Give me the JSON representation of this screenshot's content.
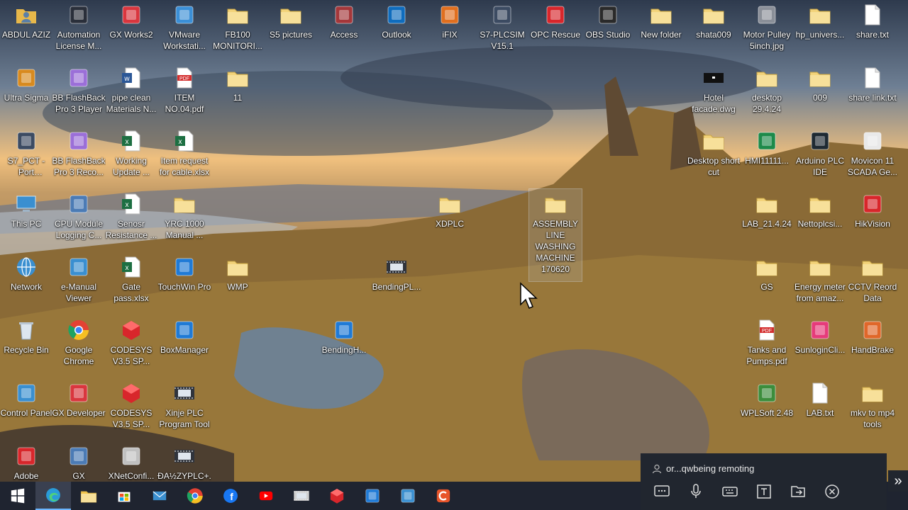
{
  "desktop": {
    "icons": [
      {
        "label": "ABDUL AZIZ",
        "icon": "user-folder-icon",
        "color": "#e8b84a"
      },
      {
        "label": "Automation License M...",
        "icon": "license-manager-icon",
        "color": "#2a2f3a"
      },
      {
        "label": "GX Works2",
        "icon": "gx-works-icon",
        "color": "#d9363e"
      },
      {
        "label": "VMware Workstati...",
        "icon": "vmware-icon",
        "color": "#3b8fd6"
      },
      {
        "label": "FB100 MONITORI...",
        "icon": "folder-icon",
        "color": "#f3d37a"
      },
      {
        "label": "S5 pictures",
        "icon": "folder-icon",
        "color": "#f3d37a"
      },
      {
        "label": "Access",
        "icon": "access-icon",
        "color": "#a4373a"
      },
      {
        "label": "Outlook",
        "icon": "outlook-icon",
        "color": "#0f6cbd"
      },
      {
        "label": "iFIX",
        "icon": "ifix-icon",
        "color": "#e06f1f"
      },
      {
        "label": "S7-PLCSIM V15.1",
        "icon": "plcsim-icon",
        "color": "#3c4b62"
      },
      {
        "label": "OPC Rescue",
        "icon": "opc-rescue-icon",
        "color": "#d8262b"
      },
      {
        "label": "OBS Studio",
        "icon": "obs-icon",
        "color": "#2a2a2a"
      },
      {
        "label": "New folder",
        "icon": "folder-icon",
        "color": "#f3d37a"
      },
      {
        "label": "shata009",
        "icon": "folder-icon",
        "color": "#f3d37a"
      },
      {
        "label": "Motor Pulley 5inch.jpg",
        "icon": "image-file-icon",
        "color": "#8a8f98"
      },
      {
        "label": "hp_univers...",
        "icon": "folder-icon",
        "color": "#f3d37a"
      },
      {
        "label": "share.txt",
        "icon": "text-file-icon",
        "color": "#ffffff"
      },
      {
        "label": "Ultra Sigma",
        "icon": "ultra-sigma-icon",
        "color": "#d88a1f"
      },
      {
        "label": "BB FlashBack Pro 3 Player",
        "icon": "flashback-icon",
        "color": "#9b6fd8"
      },
      {
        "label": "pipe clean Materials N...",
        "icon": "word-file-icon",
        "color": "#2b5797"
      },
      {
        "label": "ITEM NO.04.pdf",
        "icon": "pdf-file-icon",
        "color": "#d32f2f"
      },
      {
        "label": "11",
        "icon": "folder-icon",
        "color": "#f3d37a"
      },
      {
        "label": "Hotel facade.dwg",
        "icon": "dwg-file-icon",
        "color": "#111111"
      },
      {
        "label": "desktop 29.4.24",
        "icon": "folder-icon",
        "color": "#f3d37a"
      },
      {
        "label": "009",
        "icon": "folder-icon",
        "color": "#f3d37a"
      },
      {
        "label": "share link.txt",
        "icon": "text-file-icon",
        "color": "#ffffff"
      },
      {
        "label": "S7_PCT - Port Configurati...",
        "icon": "s7-pct-icon",
        "color": "#3c4b62"
      },
      {
        "label": "BB FlashBack Pro 3 Reco...",
        "icon": "flashback-recorder-icon",
        "color": "#9b6fd8"
      },
      {
        "label": "Working Update ...",
        "icon": "excel-file-icon",
        "color": "#1d6f42"
      },
      {
        "label": "Item request for cable.xlsx",
        "icon": "excel-file-icon",
        "color": "#1d6f42"
      },
      {
        "label": "Desktop short cut",
        "icon": "folder-icon",
        "color": "#f3d37a"
      },
      {
        "label": "HMI11111...",
        "icon": "hmi-icon",
        "color": "#1d8a4a"
      },
      {
        "label": "Arduino PLC IDE",
        "icon": "arduino-icon",
        "color": "#1f2a33"
      },
      {
        "label": "Movicon 11 SCADA Ge...",
        "icon": "movicon-icon",
        "color": "#e9e9e9"
      },
      {
        "label": "This PC",
        "icon": "pc-icon",
        "color": "#3a8fd0"
      },
      {
        "label": "CPU Module Logging C...",
        "icon": "cpu-logging-icon",
        "color": "#4b7bb5"
      },
      {
        "label": "Senosr Resistance ...",
        "icon": "excel-file-icon",
        "color": "#1d6f42"
      },
      {
        "label": "YRC 1000 Manual ...",
        "icon": "folder-icon",
        "color": "#f3d37a"
      },
      {
        "label": "XDPLC",
        "icon": "folder-icon",
        "color": "#f3d37a"
      },
      {
        "label": "ASSEMBLY LINE WASHING MACHINE 170620",
        "icon": "folder-icon",
        "color": "#f3d37a"
      },
      {
        "label": "LAB_21.4.24",
        "icon": "folder-icon",
        "color": "#f3d37a"
      },
      {
        "label": "Nettoplcsi...",
        "icon": "folder-icon",
        "color": "#f3d37a"
      },
      {
        "label": "HikVision",
        "icon": "hikvision-icon",
        "color": "#d8262b"
      },
      {
        "label": "Network",
        "icon": "network-icon",
        "color": "#3a8fd0"
      },
      {
        "label": "e-Manual Viewer",
        "icon": "emanual-icon",
        "color": "#3a8fd0"
      },
      {
        "label": "Gate pass.xlsx",
        "icon": "excel-file-icon",
        "color": "#1d6f42"
      },
      {
        "label": "TouchWin Pro",
        "icon": "touchwin-icon",
        "color": "#1f7ad6"
      },
      {
        "label": "WMP",
        "icon": "folder-icon",
        "color": "#f3d37a"
      },
      {
        "label": "BendingPL...",
        "icon": "film-icon",
        "color": "#30343c"
      },
      {
        "label": "GS",
        "icon": "folder-icon",
        "color": "#f3d37a"
      },
      {
        "label": "Energy meter from amaz...",
        "icon": "folder-icon",
        "color": "#f3d37a"
      },
      {
        "label": "CCTV Reord Data",
        "icon": "folder-icon",
        "color": "#f3d37a"
      },
      {
        "label": "Recycle Bin",
        "icon": "recycle-bin-icon",
        "color": "#cfd8e0"
      },
      {
        "label": "Google Chrome",
        "icon": "chrome-icon",
        "color": "#e34133"
      },
      {
        "label": "CODESYS V3.5 SP...",
        "icon": "codesys-icon",
        "color": "#d8262b"
      },
      {
        "label": "BoxManager",
        "icon": "box-manager-icon",
        "color": "#1f7ad6"
      },
      {
        "label": "BendingH...",
        "icon": "touchwin-file-icon",
        "color": "#1f7ad6"
      },
      {
        "label": "Tanks and Pumps.pdf",
        "icon": "pdf-file-icon",
        "color": "#d32f2f"
      },
      {
        "label": "SunloginCli...",
        "icon": "sunlogin-icon",
        "color": "#e63b7a"
      },
      {
        "label": "HandBrake",
        "icon": "handbrake-icon",
        "color": "#e0672a"
      },
      {
        "label": "Control Panel",
        "icon": "control-panel-icon",
        "color": "#3a8fd0"
      },
      {
        "label": "GX Developer",
        "icon": "gx-developer-icon",
        "color": "#d9363e"
      },
      {
        "label": "CODESYS V3.5 SP...",
        "icon": "codesys-icon",
        "color": "#d8262b"
      },
      {
        "label": "Xinje PLC Program Tool",
        "icon": "film-icon",
        "color": "#30343c"
      },
      {
        "label": "WPLSoft 2.48",
        "icon": "wplsoft-icon",
        "color": "#3c8d3c"
      },
      {
        "label": "LAB.txt",
        "icon": "text-file-icon",
        "color": "#ffffff"
      },
      {
        "label": "mkv to mp4 tools",
        "icon": "folder-icon",
        "color": "#f3d37a"
      },
      {
        "label": "Adobe",
        "icon": "adobe-icon",
        "color": "#d8262b"
      },
      {
        "label": "GX",
        "icon": "gx-icon",
        "color": "#4b7bb5"
      },
      {
        "label": "XNetConfi...",
        "icon": "xnet-icon",
        "color": "#c0c0c0"
      },
      {
        "label": "ĐA½ZYPLC+...",
        "icon": "film-icon",
        "color": "#30343c"
      }
    ]
  },
  "taskbar": {
    "items": [
      {
        "name": "start-button",
        "icon": "windows-icon",
        "color": "#ffffff",
        "active": false
      },
      {
        "name": "edge",
        "icon": "edge-icon",
        "color": "#2a9bd8",
        "active": true
      },
      {
        "name": "file-explorer",
        "icon": "folder-icon",
        "color": "#f3c54a",
        "active": false
      },
      {
        "name": "store",
        "icon": "store-icon",
        "color": "#e9e9e9",
        "active": false
      },
      {
        "name": "mail",
        "icon": "mail-icon",
        "color": "#3a8fd0",
        "active": false
      },
      {
        "name": "chrome",
        "icon": "chrome-icon",
        "color": "#e34133",
        "active": false
      },
      {
        "name": "facebook",
        "icon": "facebook-icon",
        "color": "#1877f2",
        "active": false
      },
      {
        "name": "youtube",
        "icon": "youtube-icon",
        "color": "#ff0000",
        "active": false
      },
      {
        "name": "xinje",
        "icon": "film-icon",
        "color": "#d0d0d0",
        "active": false
      },
      {
        "name": "codesys",
        "icon": "codesys-icon",
        "color": "#d8262b",
        "active": false
      },
      {
        "name": "touchwin",
        "icon": "touchwin-icon",
        "color": "#1f7ad6",
        "active": false
      },
      {
        "name": "remote",
        "icon": "remote-icon",
        "color": "#3a8fd0",
        "active": false
      },
      {
        "name": "cclean",
        "icon": "c-icon",
        "color": "#e8542a",
        "active": false
      }
    ]
  },
  "remote_panel": {
    "user_text": "or...qwbeing remoting",
    "tools": [
      "chat-icon",
      "microphone-icon",
      "keyboard-icon",
      "text-icon",
      "file-transfer-icon",
      "close-icon"
    ],
    "expand_glyph": "»"
  }
}
